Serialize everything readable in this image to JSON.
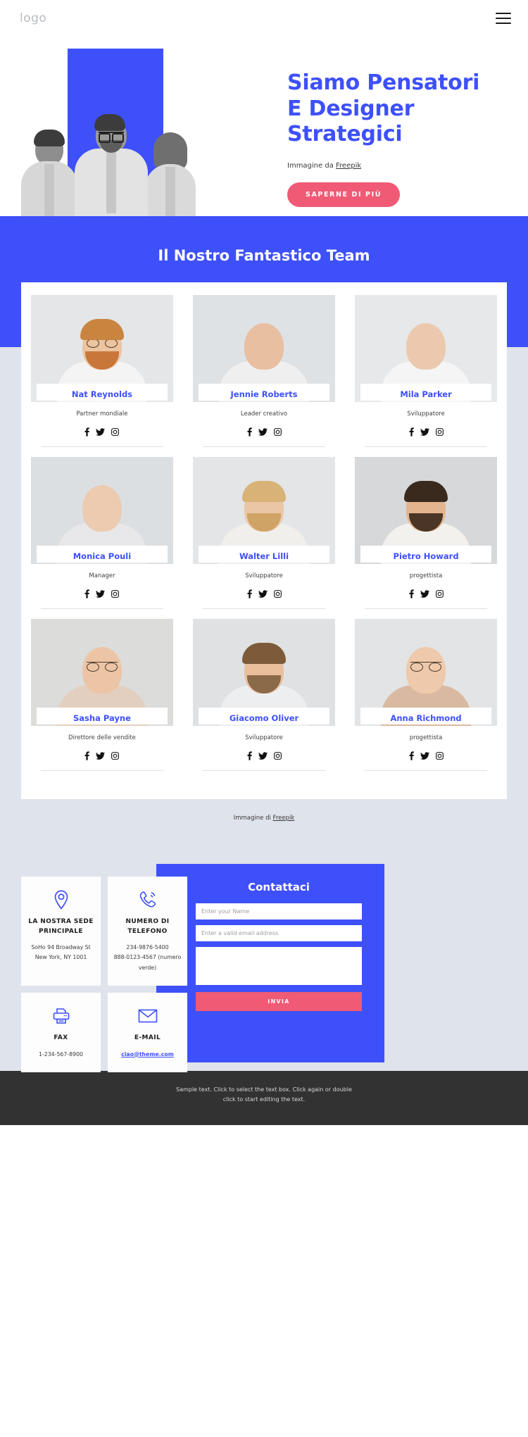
{
  "header": {
    "logo": "logo",
    "menu_icon": "hamburger-menu-icon"
  },
  "hero": {
    "title_line1": "Siamo Pensatori",
    "title_line2": "E Designer",
    "title_line3": "Strategici",
    "credit_prefix": "Immagine da ",
    "credit_link": "Freepik",
    "cta_label": "SAPERNE DI PIÙ",
    "accent_blue": "#3e50fa",
    "accent_pink": "#f05a75"
  },
  "team": {
    "heading": "Il Nostro Fantastico Team",
    "credit_prefix": "Immagine di ",
    "credit_link": "Freepik",
    "social_icons": [
      "facebook-icon",
      "twitter-icon",
      "instagram-icon"
    ],
    "members": [
      {
        "name": "Nat Reynolds",
        "role": "Partner mondiale"
      },
      {
        "name": "Jennie Roberts",
        "role": "Leader creativo"
      },
      {
        "name": "Mila Parker",
        "role": "Sviluppatore"
      },
      {
        "name": "Monica Pouli",
        "role": "Manager"
      },
      {
        "name": "Walter Lilli",
        "role": "Sviluppatore"
      },
      {
        "name": "Pietro Howard",
        "role": "progettista"
      },
      {
        "name": "Sasha Payne",
        "role": "Direttore delle vendite"
      },
      {
        "name": "Giacomo Oliver",
        "role": "Sviluppatore"
      },
      {
        "name": "Anna Richmond",
        "role": "progettista"
      }
    ]
  },
  "contact": {
    "cards": [
      {
        "icon": "location-pin-icon",
        "title": "LA NOSTRA SEDE PRINCIPALE",
        "line1": "SoHo 94 Broadway St",
        "line2": "New York, NY 1001"
      },
      {
        "icon": "phone-ring-icon",
        "title": "NUMERO DI TELEFONO",
        "line1": "234-9876-5400",
        "line2": "888-0123-4567 (numero verde)"
      },
      {
        "icon": "printer-icon",
        "title": "FAX",
        "line1": "1-234-567-8900",
        "line2": ""
      },
      {
        "icon": "envelope-icon",
        "title": "E-MAIL",
        "line1": "ciao@theme.com",
        "line2": ""
      }
    ],
    "form": {
      "title": "Contattaci",
      "name_placeholder": "Enter your Name",
      "name_value": "",
      "email_placeholder": "Enter a valid email address",
      "email_value": "",
      "message_placeholder": "",
      "message_value": "",
      "submit_label": "INVIA"
    }
  },
  "footer": {
    "line1": "Sample text. Click to select the text box. Click again or double",
    "line2": "click to start editing the text."
  }
}
